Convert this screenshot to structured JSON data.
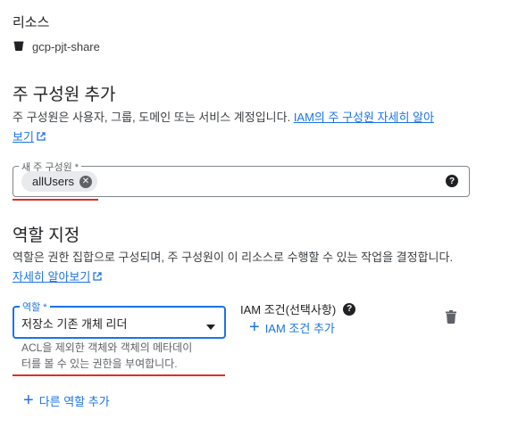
{
  "resource": {
    "section_label": "리소스",
    "icon": "bucket-icon",
    "name": "gcp-pjt-share"
  },
  "add_principals": {
    "title": "주 구성원 추가",
    "description": "주 구성원은 사용자, 그룹, 도메인 또는 서비스 계정입니다. ",
    "learn_more_link_line1": "IAM의 주 구성원 자세히 알아",
    "learn_more_link_line2": "보기",
    "new_principal_label": "새 주 구성원 *",
    "chip_value": "allUsers",
    "help_icon": "help-icon"
  },
  "assign_roles": {
    "title": "역할 지정",
    "description": "역할은 권한 집합으로 구성되며, 주 구성원이 이 리소스로 수행할 수 있는 작업을 결정합니다.",
    "learn_more_link": "자세히 알아보기",
    "role_label": "역할 *",
    "role_value": "저장소 기존 개체 리더",
    "role_helper_line1": "ACL을 제외한 객체와 객체의 메타데이",
    "role_helper_line2": "터를 볼 수 있는 권한을 부여합니다.",
    "iam_condition_label": "IAM 조건(선택사항)",
    "add_iam_condition": "IAM 조건 추가",
    "add_another_role": "다른 역할 추가"
  },
  "colors": {
    "accent": "#1a73e8",
    "underline_red": "#d93025"
  }
}
